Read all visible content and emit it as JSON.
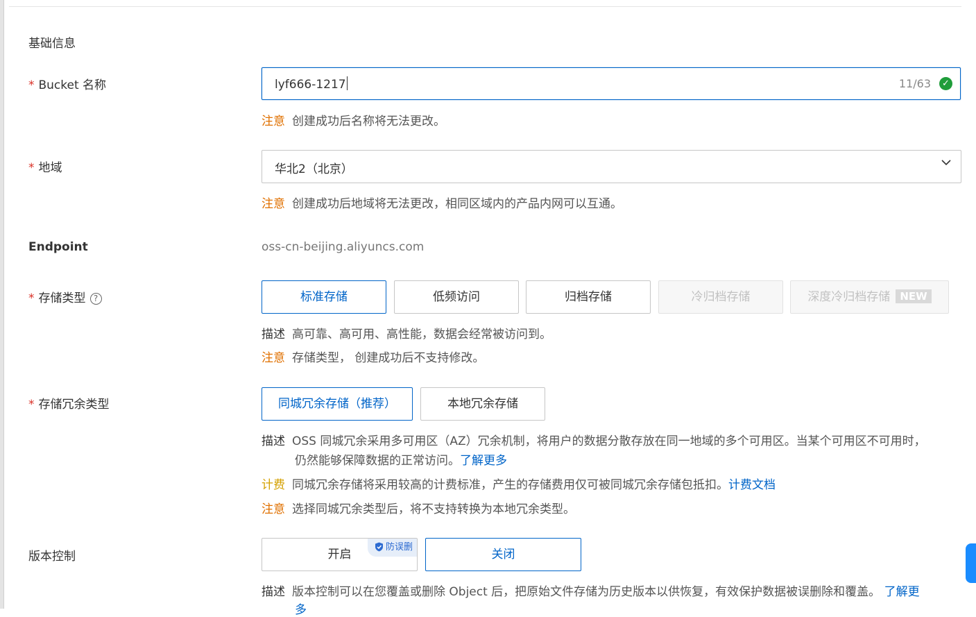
{
  "section_title": "基础信息",
  "bucket_name": {
    "label": "Bucket 名称",
    "value": "lyf666-1217",
    "counter": "11/63",
    "note_tag": "注意",
    "note_text": "创建成功后名称将无法更改。"
  },
  "region": {
    "label": "地域",
    "value": "华北2（北京）",
    "note_tag": "注意",
    "note_text": "创建成功后地域将无法更改，相同区域内的产品内网可以互通。"
  },
  "endpoint": {
    "label": "Endpoint",
    "value": "oss-cn-beijing.aliyuncs.com"
  },
  "storage_class": {
    "label": "存储类型",
    "options": [
      "标准存储",
      "低频访问",
      "归档存储",
      "冷归档存储",
      "深度冷归档存储"
    ],
    "selected": "标准存储",
    "new_badge": "NEW",
    "desc_tag": "描述",
    "desc_text": "高可靠、高可用、高性能，数据会经常被访问到。",
    "note_tag": "注意",
    "note_text": "存储类型， 创建成功后不支持修改。"
  },
  "redundancy": {
    "label": "存储冗余类型",
    "options": [
      "同城冗余存储（推荐）",
      "本地冗余存储"
    ],
    "selected": "同城冗余存储（推荐）",
    "desc_tag": "描述",
    "desc_line1": "OSS 同城冗余采用多可用区（AZ）冗余机制，将用户的数据分散存放在同一地域的多个可用区。当某个可用区不可用时，",
    "desc_line2": "仍然能够保障数据的正常访问。",
    "desc_link": "了解更多",
    "fee_tag": "计费",
    "fee_text": "同城冗余存储将采用较高的计费标准，产生的存储费用仅可被同城冗余存储包抵扣。",
    "fee_link": "计费文档",
    "note_tag": "注意",
    "note_text": "选择同城冗余类型后，将不支持转换为本地冗余类型。"
  },
  "versioning": {
    "label": "版本控制",
    "options": [
      "开启",
      "关闭"
    ],
    "selected": "关闭",
    "badge": "防误删",
    "desc_tag": "描述",
    "desc_text": "版本控制可以在您覆盖或删除 Object 后，把原始文件存储为历史版本以供恢复，有效保护数据被误删除和覆盖。",
    "desc_link": "了解更",
    "desc_link_cont": "多"
  },
  "colors": {
    "primary": "#0064c8",
    "required": "#d93026",
    "warn": "#e07000",
    "fee": "#d4a000",
    "success": "#1f9d3a"
  }
}
